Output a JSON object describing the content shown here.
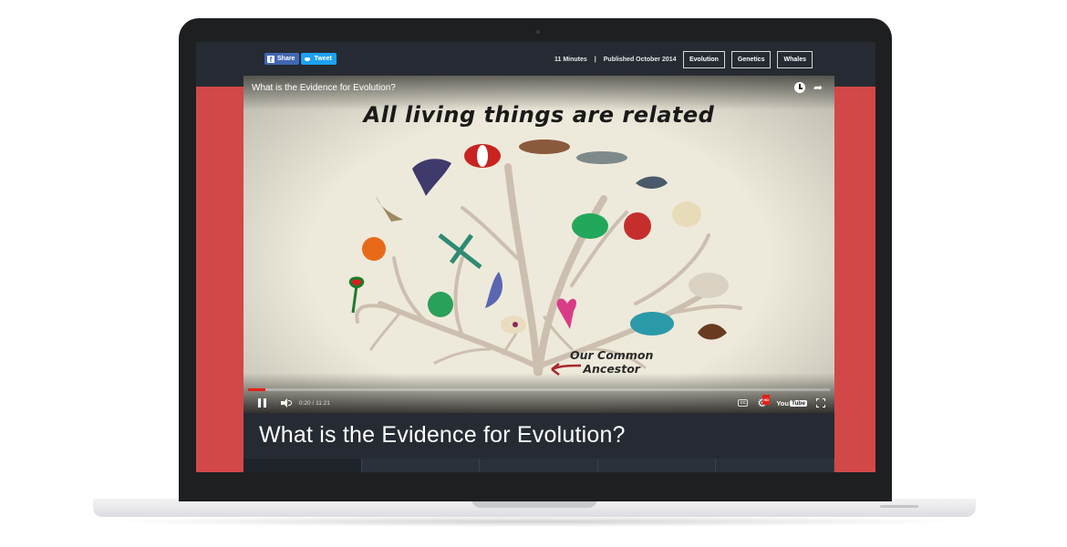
{
  "topbar": {
    "share_label": "Share",
    "tweet_label": "Tweet",
    "duration": "11 Minutes",
    "separator": "|",
    "published": "Published October 2014",
    "tags": [
      "Evolution",
      "Genetics",
      "Whales"
    ]
  },
  "video": {
    "title": "What is the Evidence for Evolution?",
    "headline": "All living things are related",
    "ancestor_line1": "Our Common",
    "ancestor_line2": "Ancestor",
    "time": "0:20 / 11:21",
    "progress_fraction": 0.03,
    "icons": [
      "clock-icon",
      "share-arrow-icon",
      "pause-icon",
      "volume-icon",
      "cc-icon",
      "gear-icon",
      "youtube-logo",
      "fullscreen-icon"
    ],
    "youtube_label": "You",
    "youtube_tube": "Tube",
    "cc_label": "CC",
    "hd_label": "HD"
  },
  "page": {
    "title": "What is the Evidence for Evolution?"
  },
  "colors": {
    "accent_red": "#d24748",
    "dark_bar": "#262b33",
    "progress_red": "#e62117"
  }
}
